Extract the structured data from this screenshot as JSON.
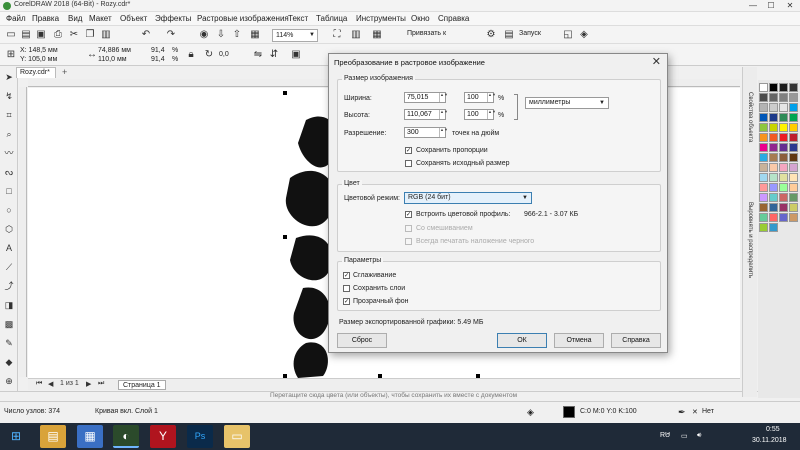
{
  "window": {
    "title": "CorelDRAW 2018 (64-Bit) - Rozy.cdr*",
    "controls": [
      "—",
      "☐",
      "✕"
    ]
  },
  "menu": [
    "Файл",
    "Правка",
    "Вид",
    "Макет",
    "Объект",
    "Эффекты",
    "Растровые изображения",
    "Текст",
    "Таблица",
    "Инструменты",
    "Окно",
    "Справка"
  ],
  "toolbar": {
    "zoom": "114%",
    "snap_label": "Привязать к",
    "launch_label": "Запуск"
  },
  "properties": {
    "x": "X: 148,5 мм",
    "y": "Y: 105,0 мм",
    "width": "74,886 мм",
    "height": "110,0 мм",
    "scale_w": "91,4",
    "scale_h": "91,4",
    "pct": "%",
    "rotation": "0,0"
  },
  "document_tab": "Rozy.cdr*",
  "pager": {
    "count": "1 из 1",
    "page_tab": "Страница 1"
  },
  "hint": "Перетащите сюда цвета (или объекты), чтобы сохранить их вместе с документом",
  "status": {
    "nodes": "Число узлов: 374",
    "curve": "Кривая вкл. Слой 1",
    "color": "C:0 M:0 Y:0 K:100",
    "outline": "Нет"
  },
  "dockers": [
    "Свойства объекта",
    "Выровнять и распределить"
  ],
  "palette_colors": [
    "#ffffff",
    "#000000",
    "#1a1a1a",
    "#333333",
    "#4d4d4d",
    "#666666",
    "#808080",
    "#999999",
    "#b3b3b3",
    "#cccccc",
    "#e6e6e6",
    "#00a0e9",
    "#0057b8",
    "#1e3a8a",
    "#2e8b57",
    "#00a651",
    "#8dc63f",
    "#c8d400",
    "#fff200",
    "#ffcd00",
    "#f7941d",
    "#f15a24",
    "#ed1c24",
    "#be1e2d",
    "#ec008c",
    "#92278f",
    "#662d91",
    "#2b3990",
    "#29abe2",
    "#a67c52",
    "#8b5e3c",
    "#603913",
    "#c7b299",
    "#f9c9a8",
    "#f4a6c0",
    "#d4a5d0",
    "#a0d8ef",
    "#b5e3c8",
    "#e0e0a0",
    "#ffe4b5",
    "#ff9999",
    "#9999ff",
    "#99ff99",
    "#ffcc99",
    "#cc99ff",
    "#66cccc",
    "#cc6666",
    "#669966",
    "#996633",
    "#336699",
    "#993366",
    "#cccc66",
    "#66cc99",
    "#ff6666",
    "#6666cc",
    "#cc9966",
    "#99cc33",
    "#3399cc"
  ],
  "dialog": {
    "title": "Преобразование в растровое изображение",
    "size_group": "Размер изображения",
    "width_label": "Ширина:",
    "width_value": "75,015",
    "width_pct": "100",
    "height_label": "Высота:",
    "height_value": "110,067",
    "height_pct": "100",
    "pct_sign": "%",
    "units": "миллиметры",
    "resolution_label": "Разрешение:",
    "resolution_value": "300",
    "resolution_unit": "точек на дюйм",
    "keep_ratio": "Сохранить пропорции",
    "keep_size": "Сохранять исходный размер",
    "color_group": "Цвет",
    "color_mode_label": "Цветовой режим:",
    "color_mode_value": "RGB (24 бит)",
    "embed_profile": "Встроить цветовой профиль:",
    "profile_info": "966-2.1 - 3.07 КБ",
    "dithered": "Со смешиванием",
    "overprint_black": "Всегда печатать наложение черного",
    "params_group": "Параметры",
    "antialias": "Сглаживание",
    "keep_layers": "Сохранить слои",
    "transparent_bg": "Прозрачный фон",
    "export_size": "Размер экспортированной графики: 5.49 МБ",
    "reset": "Сброс",
    "ok": "ОК",
    "cancel": "Отмена",
    "help": "Справка"
  },
  "taskbar": {
    "lang": "RU",
    "time": "0:55",
    "date": "30.11.2018"
  }
}
